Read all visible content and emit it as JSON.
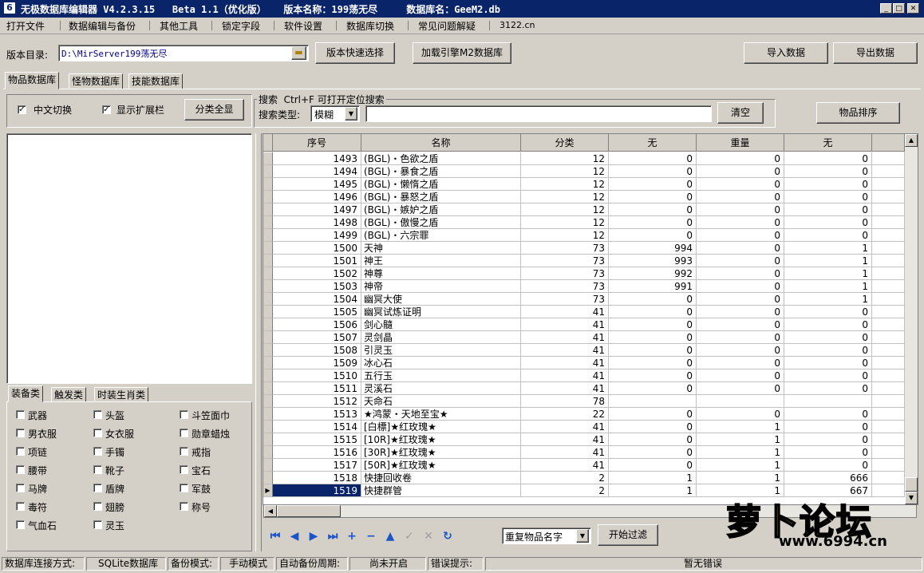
{
  "window": {
    "title": "无极数据库编辑器 V4.2.3.15   Beta 1.1（优化版）   版本名称：199荡无尽     数据库名：GeeM2.db",
    "min_icon": "minimize-icon",
    "max_icon": "maximize-icon",
    "close_icon": "close-icon"
  },
  "menu": [
    "打开文件",
    "数据编辑与备份",
    "其他工具",
    "锁定字段",
    "软件设置",
    "数据库切换",
    "常见问题解疑",
    "3122.cn"
  ],
  "toolbar": {
    "dir_label": "版本目录:",
    "dir_value": "D:\\MirServer199荡无尽",
    "quick_select": "版本快速选择",
    "load_engine": "加载引擎M2数据库",
    "import": "导入数据",
    "export": "导出数据"
  },
  "tabs": [
    "物品数据库",
    "怪物数据库",
    "技能数据库"
  ],
  "options": {
    "chinese_switch": "中文切换",
    "show_ext": "显示扩展栏",
    "show_all": "分类全显",
    "chinese_checked": true,
    "ext_checked": true
  },
  "search": {
    "group_label": "搜索  Ctrl+F 可打开定位搜索",
    "type_label": "搜索类型:",
    "type_value": "模糊",
    "clear": "清空",
    "sort": "物品排序"
  },
  "category_tabs": [
    "装备类",
    "触发类",
    "时装生肖类"
  ],
  "categories": [
    "武器",
    "头盔",
    "斗笠面巾",
    "男衣服",
    "女衣服",
    "勋章蜡烛",
    "项链",
    "手镯",
    "戒指",
    "腰带",
    "靴子",
    "宝石",
    "马牌",
    "盾牌",
    "军鼓",
    "毒符",
    "翅膀",
    "称号",
    "气血石",
    "灵玉"
  ],
  "grid": {
    "columns": [
      "序号",
      "名称",
      "分类",
      "无",
      "重量",
      "无"
    ],
    "rows": [
      [
        "1493",
        "(BGL)・色欲之盾",
        "12",
        "0",
        "0",
        "0"
      ],
      [
        "1494",
        "(BGL)・暴食之盾",
        "12",
        "0",
        "0",
        "0"
      ],
      [
        "1495",
        "(BGL)・懒惰之盾",
        "12",
        "0",
        "0",
        "0"
      ],
      [
        "1496",
        "(BGL)・暴怒之盾",
        "12",
        "0",
        "0",
        "0"
      ],
      [
        "1497",
        "(BGL)・嫉妒之盾",
        "12",
        "0",
        "0",
        "0"
      ],
      [
        "1498",
        "(BGL)・傲慢之盾",
        "12",
        "0",
        "0",
        "0"
      ],
      [
        "1499",
        "(BGL)・六宗罪",
        "12",
        "0",
        "0",
        "0"
      ],
      [
        "1500",
        "天神",
        "73",
        "994",
        "0",
        "1"
      ],
      [
        "1501",
        "神王",
        "73",
        "993",
        "0",
        "1"
      ],
      [
        "1502",
        "神尊",
        "73",
        "992",
        "0",
        "1"
      ],
      [
        "1503",
        "神帝",
        "73",
        "991",
        "0",
        "1"
      ],
      [
        "1504",
        "幽冥大使",
        "73",
        "0",
        "0",
        "1"
      ],
      [
        "1505",
        "幽冥试炼证明",
        "41",
        "0",
        "0",
        "0"
      ],
      [
        "1506",
        "剑心髓",
        "41",
        "0",
        "0",
        "0"
      ],
      [
        "1507",
        "灵剑晶",
        "41",
        "0",
        "0",
        "0"
      ],
      [
        "1508",
        "引灵玉",
        "41",
        "0",
        "0",
        "0"
      ],
      [
        "1509",
        "冰心石",
        "41",
        "0",
        "0",
        "0"
      ],
      [
        "1510",
        "五行玉",
        "41",
        "0",
        "0",
        "0"
      ],
      [
        "1511",
        "灵溪石",
        "41",
        "0",
        "0",
        "0"
      ],
      [
        "1512",
        "天命石",
        "78",
        "",
        "",
        ""
      ],
      [
        "1513",
        "★鸿蒙・天地至宝★",
        "22",
        "0",
        "0",
        "0"
      ],
      [
        "1514",
        "[白標]★红玫瑰★",
        "41",
        "0",
        "1",
        "0"
      ],
      [
        "1515",
        "[10R]★红玫瑰★",
        "41",
        "0",
        "1",
        "0"
      ],
      [
        "1516",
        "[30R]★红玫瑰★",
        "41",
        "0",
        "1",
        "0"
      ],
      [
        "1517",
        "[50R]★红玫瑰★",
        "41",
        "0",
        "1",
        "0"
      ],
      [
        "1518",
        "快捷回收卷",
        "2",
        "1",
        "1",
        "666"
      ],
      [
        "1519",
        "快捷群管",
        "2",
        "1",
        "1",
        "667"
      ]
    ],
    "selected_row": "1519"
  },
  "nav": {
    "icons": [
      "first-icon",
      "prev-icon",
      "next-icon",
      "last-icon",
      "add-icon",
      "delete-icon",
      "edit-icon",
      "post-icon",
      "cancel-icon",
      "refresh-icon"
    ],
    "filter_value": "重复物品名字",
    "filter_button": "开始过滤"
  },
  "status": {
    "conn_label": "数据库连接方式:",
    "conn_value": "SQLite数据库",
    "backup_label": "备份模式:",
    "backup_value": "手动模式",
    "auto_label": "自动备份周期:",
    "auto_value": "尚未开启",
    "error_label": "错误提示:",
    "error_value": "暂无错误"
  },
  "watermark": {
    "text": "萝卜论坛",
    "url": "www.6994.cn"
  }
}
